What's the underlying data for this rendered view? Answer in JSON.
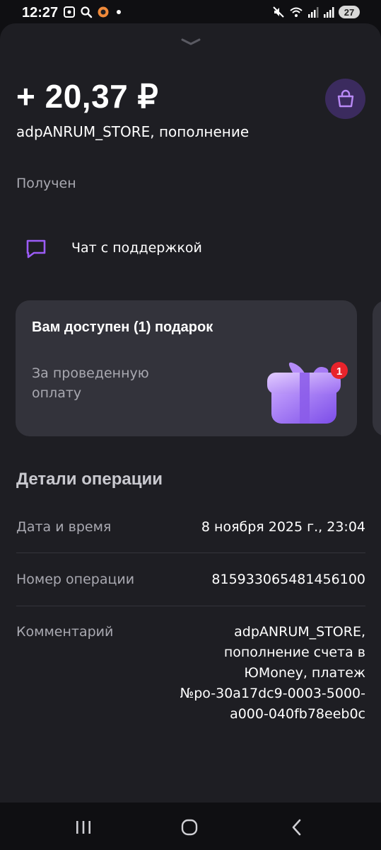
{
  "status_bar": {
    "time": "12:27",
    "battery": "27",
    "left_icons": [
      "screenshot-icon",
      "search-icon",
      "app-notification-icon",
      "dot-icon"
    ],
    "right_icons": [
      "mute-icon",
      "wifi-icon",
      "signal-icon",
      "signal-icon"
    ]
  },
  "transaction": {
    "amount": "+ 20,37 ₽",
    "merchant": "adpANRUM_STORE, пополнение",
    "status": "Получен"
  },
  "support": {
    "label": "Чат с поддержкой"
  },
  "gift_card": {
    "title": "Вам доступен (1) подарок",
    "subtitle": "За проведенную оплату",
    "badge": "1"
  },
  "details": {
    "title": "Детали операции",
    "rows": [
      {
        "label": "Дата и время",
        "value": "8 ноября 2025 г., 23:04"
      },
      {
        "label": "Номер операции",
        "value": "815933065481456100"
      },
      {
        "label": "Комментарий",
        "lines": [
          "adpANRUM_STORE,",
          "пополнение счета в",
          "ЮMoney, платеж",
          "№po-30a17dc9-0003-5000-",
          "a000-040fb78eeb0c"
        ]
      }
    ]
  },
  "colors": {
    "sheet_background": "#1e1e23",
    "card_background": "#33333b",
    "accent_purple": "#9b5cf6",
    "muted_text": "#a9a9b1"
  }
}
